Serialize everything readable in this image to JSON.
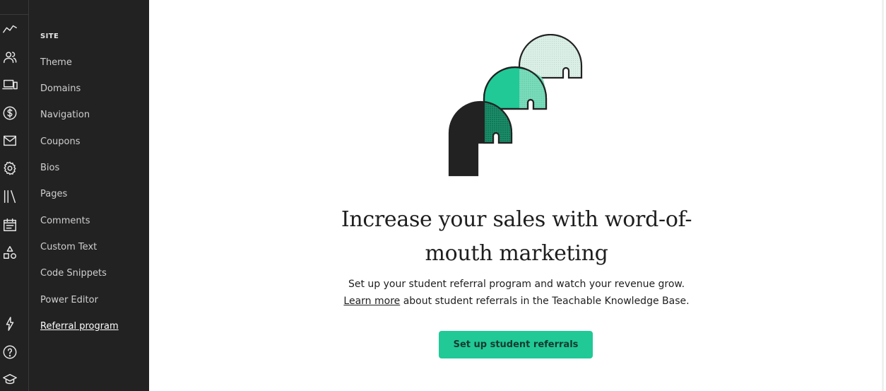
{
  "rail": {
    "icons": [
      "analytics-icon",
      "users-icon",
      "site-icon",
      "sales-icon",
      "email-icon",
      "settings-icon",
      "library-icon",
      "calendar-icon",
      "shapes-icon",
      "lightning-icon",
      "help-icon",
      "graduation-cap-icon"
    ]
  },
  "sidebar": {
    "section_title": "SITE",
    "items": [
      {
        "label": "Theme"
      },
      {
        "label": "Domains"
      },
      {
        "label": "Navigation"
      },
      {
        "label": "Coupons"
      },
      {
        "label": "Bios"
      },
      {
        "label": "Pages"
      },
      {
        "label": "Comments"
      },
      {
        "label": "Custom Text"
      },
      {
        "label": "Code Snippets"
      },
      {
        "label": "Power Editor"
      },
      {
        "label": "Referral program"
      }
    ],
    "active_item": "Referral program"
  },
  "main": {
    "headline": "Increase your sales with word-of-mouth marketing",
    "description": "Set up your student referral program and watch your revenue grow.",
    "learn_more_link": "Learn more",
    "learn_more_suffix": " about student referrals in the Teachable Knowledge Base.",
    "cta_label": "Set up student referrals"
  },
  "colors": {
    "sidebar_bg": "#222222",
    "accent": "#21c997",
    "text": "#1e1e1e"
  }
}
